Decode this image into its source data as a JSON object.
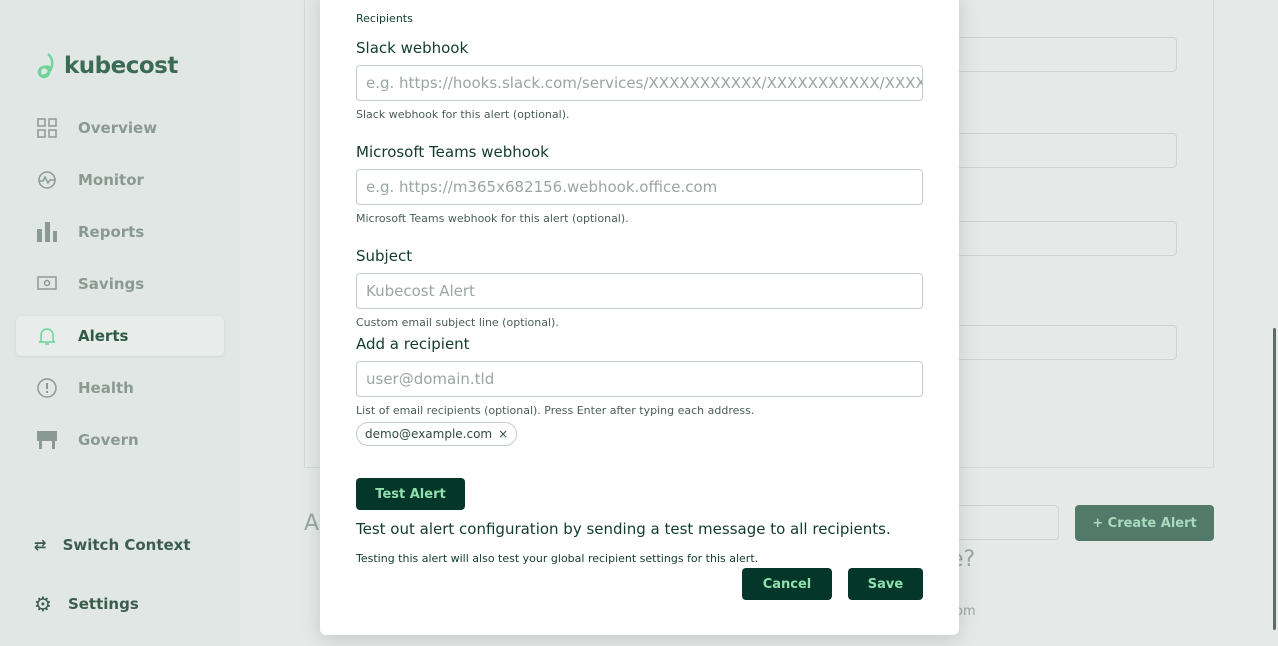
{
  "sidebar": {
    "brand": "kubecost",
    "items": [
      {
        "label": "Overview",
        "icon": "grid-icon"
      },
      {
        "label": "Monitor",
        "icon": "pulse-icon"
      },
      {
        "label": "Reports",
        "icon": "bar-chart-icon"
      },
      {
        "label": "Savings",
        "icon": "money-icon"
      },
      {
        "label": "Alerts",
        "icon": "bell-icon",
        "active": true
      },
      {
        "label": "Health",
        "icon": "alert-circle-icon"
      },
      {
        "label": "Govern",
        "icon": "govern-icon"
      }
    ],
    "switch_context": "Switch Context",
    "settings": "Settings"
  },
  "background": {
    "create_alert": "+ Create Alert",
    "frag_a": "A",
    "frag_q": "e?",
    "frag_om": "om"
  },
  "modal": {
    "recipients_heading": "Recipients",
    "slack": {
      "label": "Slack webhook",
      "placeholder": "e.g. https://hooks.slack.com/services/XXXXXXXXXXX/XXXXXXXXXXX/XXXXXXXXXXXXXXXXXXXXXXXX",
      "help": "Slack webhook for this alert (optional)."
    },
    "teams": {
      "label": "Microsoft Teams webhook",
      "placeholder": "e.g. https://m365x682156.webhook.office.com",
      "help": "Microsoft Teams webhook for this alert (optional)."
    },
    "subject": {
      "label": "Subject",
      "placeholder": "Kubecost Alert",
      "help": "Custom email subject line (optional)."
    },
    "recipient": {
      "label": "Add a recipient",
      "placeholder": "user@domain.tld",
      "help": "List of email recipients (optional). Press Enter after typing each address.",
      "chips": [
        "demo@example.com"
      ]
    },
    "test_button": "Test Alert",
    "test_desc": "Test out alert configuration by sending a test message to all recipients.",
    "test_note": "Testing this alert will also test your global recipient settings for this alert.",
    "cancel": "Cancel",
    "save": "Save"
  },
  "colors": {
    "primary": "#05362a",
    "accent": "#8fe0ae"
  }
}
